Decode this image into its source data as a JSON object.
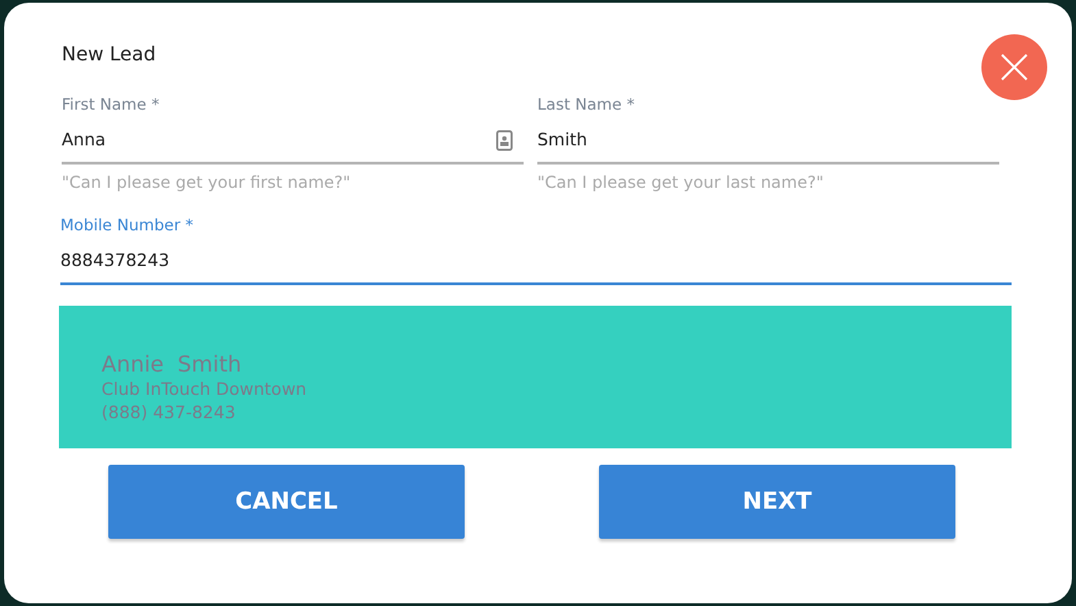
{
  "dialog": {
    "title": "New Lead"
  },
  "name_fields": [
    {
      "label": "First Name *",
      "value": "Anna",
      "hint": "\"Can I please get your first name?\"",
      "focused": false,
      "contact_button": true
    },
    {
      "label": "Last Name *",
      "value": "Smith",
      "hint": "\"Can I please get your last name?\"",
      "focused": false,
      "contact_button": false
    }
  ],
  "mobile_field": {
    "label": "Mobile Number *",
    "value": "8884378243",
    "focused": true
  },
  "match_card": {
    "first_name": "Annie",
    "last_name": "Smith",
    "club": "Club InTouch Downtown",
    "phone": "(888) 437-8243"
  },
  "buttons": [
    "CANCEL",
    "NEXT"
  ]
}
